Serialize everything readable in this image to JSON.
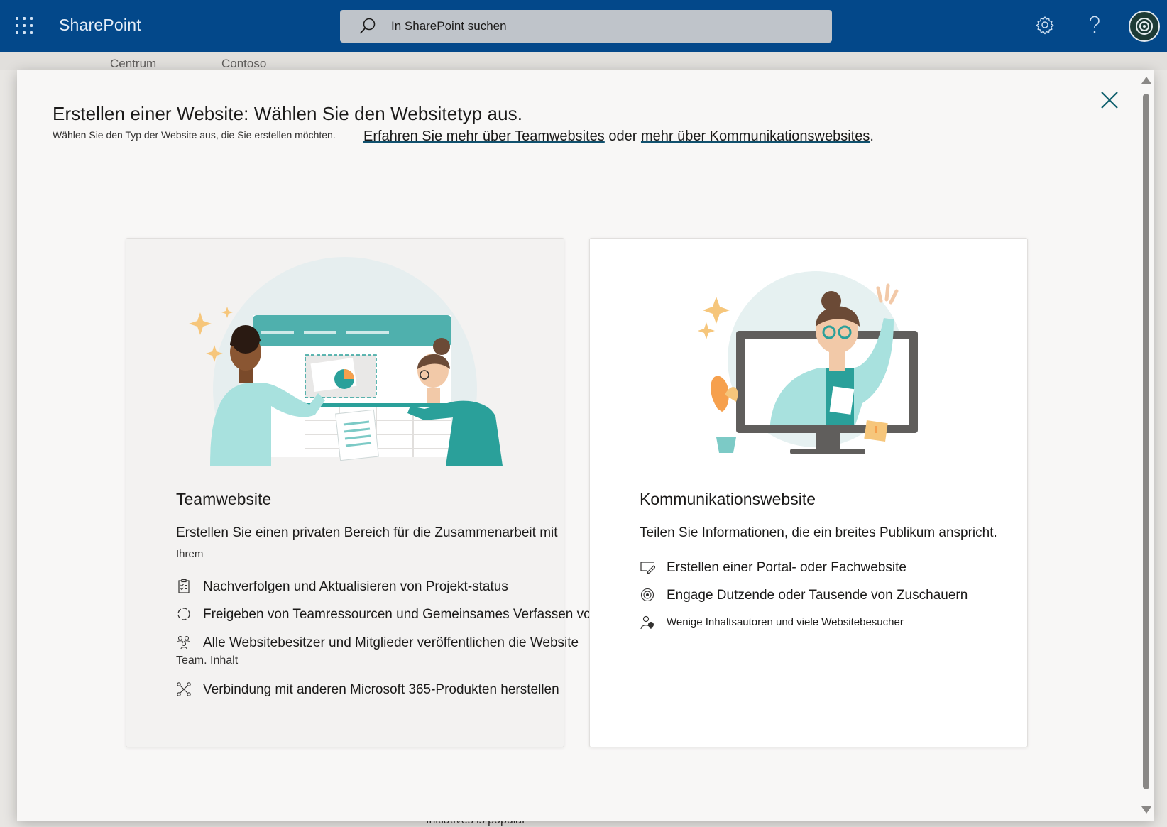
{
  "header": {
    "app_name": "SharePoint",
    "search_placeholder": "In SharePoint suchen",
    "icons": [
      "app-launcher-icon",
      "search-icon",
      "gear-icon",
      "help-icon",
      "avatar"
    ]
  },
  "background": {
    "crumb1": "Centrum",
    "crumb2": "Contoso",
    "bottom_text": "Initiatives is popular"
  },
  "dialog": {
    "title": "Erstellen einer Website: Wählen Sie den Websitetyp aus.",
    "subtitle": "Wählen Sie den Typ der Website aus, die Sie erstellen möchten.",
    "learn_team": "Erfahren Sie mehr über Teamwebsites",
    "learn_mid": " oder ",
    "learn_comm": "mehr über Kommunikationswebsites",
    "learn_end": "."
  },
  "cards": {
    "team": {
      "title": "Teamwebsite",
      "desc": "Erstellen Sie einen privaten Bereich für die Zusammenarbeit mit",
      "desc2": "Ihrem",
      "features": [
        {
          "icon": "checklist-icon",
          "text": "Nachverfolgen und Aktualisieren von Projekt-status"
        },
        {
          "icon": "sync-icon",
          "text": "Freigeben von Teamressourcen und Gemeinsames Verfassen von Inhalten"
        },
        {
          "icon": "people-icon",
          "text": "Alle Websitebesitzer und Mitglieder veröffentlichen die Website"
        },
        {
          "icon": "connect-icon",
          "text": "Verbindung mit anderen Microsoft 365-Produkten herstellen"
        }
      ],
      "feature3_cont": "Team. Inhalt"
    },
    "comm": {
      "title": "Kommunikationswebsite",
      "desc": "Teilen Sie Informationen, die ein breites Publikum anspricht.",
      "features": [
        {
          "icon": "edit-page-icon",
          "text": "Erstellen einer Portal- oder Fachwebsite"
        },
        {
          "icon": "broadcast-icon",
          "text": "Engage Dutzende oder Tausende von Zuschauern"
        },
        {
          "icon": "authors-icon",
          "text": "Wenige Inhaltsautoren und viele Websitebesucher"
        }
      ]
    }
  },
  "colors": {
    "header_bg": "#03488a",
    "teal": "#2aa09a",
    "dialog_bg": "#f8f7f6"
  }
}
